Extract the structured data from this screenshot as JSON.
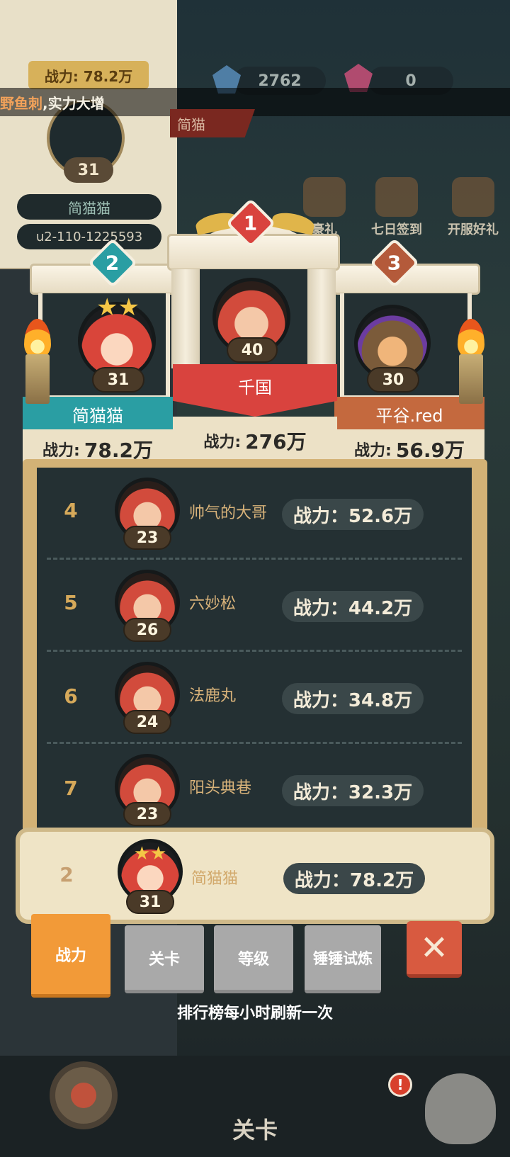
{
  "background": {
    "power_label": "战力: 78.2万",
    "level": "31",
    "name": "简猫猫",
    "user_id": "u2-110-1225593",
    "news_highlight": "野鱼刺",
    "news_text": ",实力大增",
    "currencies": [
      {
        "icon": "diamond-icon",
        "value": "2762",
        "color": "#4f7ea5"
      },
      {
        "icon": "pink-gem-icon",
        "value": "0",
        "color": "#b04b6f"
      }
    ],
    "banner": "简猫",
    "events": [
      "豪礼",
      "七日签到",
      "开服好礼"
    ],
    "stage_label": "关卡",
    "alert_badge": "!"
  },
  "podium": {
    "first": {
      "rank": "1",
      "level": "40",
      "name": "千国",
      "power_label": "战力:",
      "power_value": "276万"
    },
    "second": {
      "rank": "2",
      "level": "31",
      "name": "简猫猫",
      "power_label": "战力:",
      "power_value": "78.2万"
    },
    "third": {
      "rank": "3",
      "level": "30",
      "name": "平谷.red",
      "power_label": "战力:",
      "power_value": "56.9万"
    }
  },
  "ranking": [
    {
      "rank": "4",
      "level": "23",
      "name": "帅气的大哥",
      "power": "战力：52.6万"
    },
    {
      "rank": "5",
      "level": "26",
      "name": "六妙松",
      "power": "战力：44.2万"
    },
    {
      "rank": "6",
      "level": "24",
      "name": "法鹿丸",
      "power": "战力：34.8万"
    },
    {
      "rank": "7",
      "level": "23",
      "name": "阳头典巷",
      "power": "战力：32.3万"
    }
  ],
  "my_rank": {
    "rank": "2",
    "level": "31",
    "name": "简猫猫",
    "power": "战力：78.2万"
  },
  "tabs": [
    {
      "label": "战力",
      "active": true
    },
    {
      "label": "关卡",
      "active": false
    },
    {
      "label": "等级",
      "active": false
    },
    {
      "label": "锤锤试炼",
      "active": false
    }
  ],
  "refresh_note": "排行榜每小时刷新一次",
  "colors": {
    "rank1": "#d9433e",
    "rank2": "#2a9ea3",
    "rank3": "#b45a3a",
    "active_tab": "#f29a38",
    "close": "#d85a40"
  }
}
